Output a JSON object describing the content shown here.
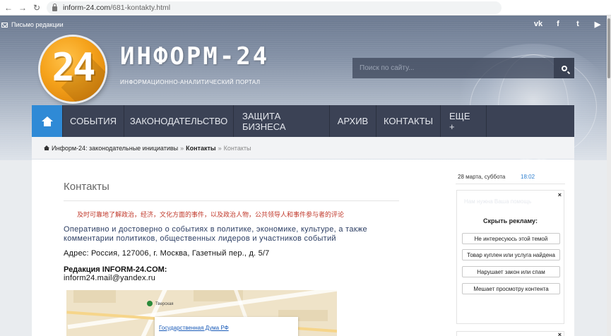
{
  "browser": {
    "domain": "inform-24.com",
    "path": "/681-kontakty.html",
    "back_icon": "←",
    "forward_icon": "→",
    "reload_icon": "↻"
  },
  "header": {
    "top_link": "Письмо редакции",
    "logo_number": "24",
    "brand": "ИНФОРМ-24",
    "tagline": "ИНФОРМАЦИОННО-АНАЛИТИЧЕСКИЙ ПОРТАЛ",
    "search_placeholder": "Поиск по сайту...",
    "social": [
      {
        "icon": "vk-icon",
        "glyph": "vk"
      },
      {
        "icon": "facebook-icon",
        "glyph": "f"
      },
      {
        "icon": "twitter-icon",
        "glyph": "t"
      },
      {
        "icon": "youtube-icon",
        "glyph": "▶"
      }
    ]
  },
  "nav": {
    "items": [
      "СОБЫТИЯ",
      "ЗАКОНОДАТЕЛЬСТВО",
      "ЗАЩИТА БИЗНЕСА",
      "АРХИВ",
      "КОНТАКТЫ",
      "ЕЩЕ +"
    ],
    "accent": "#2f8ad6"
  },
  "breadcrumb": {
    "home": "Информ-24: законодательные инициативы",
    "sep": "»",
    "current_bold": "Контакты",
    "current": "Контакты"
  },
  "main": {
    "title": "Контакты",
    "chinese_line": "及时可靠地了解政治，经济，文化方面的事件，以及政治人物，公共领导人和事件参与者的评论",
    "lead": "Оперативно и достоверно о событиях в политике, экономике, культуре, а также комментарии политиков, общественных лидеров и участников событий",
    "address": "Адрес: Россия, 127006, г. Москва, Газетный пер., д. 5/7",
    "editorial_heading": "Редакция INFORM-24.COM:",
    "editorial_email": "inform24.mail@yandex.ru",
    "map_label": "Тверская",
    "map_link": "Государственная Дума РФ"
  },
  "sidebar": {
    "date": "28 марта, суббота",
    "time": "18:02",
    "ad_close": "×",
    "ghost_text": "Нам нужна Ваша помощь",
    "hide_title": "Скрыть рекламу:",
    "options": [
      "Не интересуюсь этой темой",
      "Товар куплен или услуга найдена",
      "Нарушает закон или спам",
      "Мешает просмотру контента"
    ]
  }
}
